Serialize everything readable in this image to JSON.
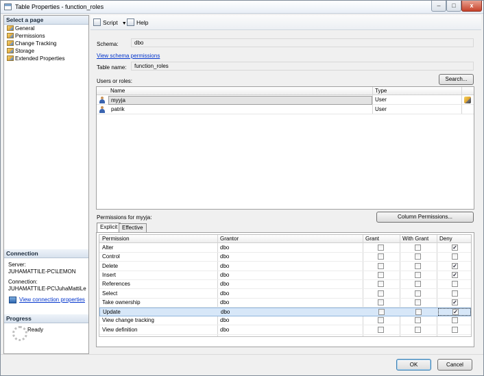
{
  "window": {
    "title": "Table Properties - function_roles",
    "controls": [
      "–",
      "□",
      "x"
    ]
  },
  "sidebar": {
    "select_page_header": "Select a page",
    "pages": [
      "General",
      "Permissions",
      "Change Tracking",
      "Storage",
      "Extended Properties"
    ],
    "connection_header": "Connection",
    "server_label": "Server:",
    "server_value": "JUHAMATTILE-PC\\LEMON",
    "connection_label": "Connection:",
    "connection_value": "JUHAMATTILE-PC\\JuhaMattiLe",
    "view_connection_link": "View connection properties",
    "progress_header": "Progress",
    "progress_status": "Ready"
  },
  "toolbar": {
    "script_label": "Script",
    "help_label": "Help"
  },
  "form": {
    "schema_label": "Schema:",
    "schema_value": "dbo",
    "view_schema_link": "View schema permissions",
    "table_name_label": "Table name:",
    "table_name_value": "function_roles",
    "users_label": "Users or roles:",
    "search_button": "Search...",
    "users_columns": [
      "Name",
      "Type"
    ],
    "users": [
      {
        "name": "myyja",
        "type": "User"
      },
      {
        "name": "patrik",
        "type": "User"
      }
    ],
    "permissions_for_label": "Permissions for myyja:",
    "column_permissions_button": "Column Permissions...",
    "tabs": [
      "Explicit",
      "Effective"
    ],
    "perm_columns": [
      "Permission",
      "Grantor",
      "Grant",
      "With Grant",
      "Deny"
    ],
    "permissions": [
      {
        "name": "Alter",
        "grantor": "dbo",
        "grant": false,
        "with_grant": false,
        "deny": true
      },
      {
        "name": "Control",
        "grantor": "dbo",
        "grant": false,
        "with_grant": false,
        "deny": false
      },
      {
        "name": "Delete",
        "grantor": "dbo",
        "grant": false,
        "with_grant": false,
        "deny": true
      },
      {
        "name": "Insert",
        "grantor": "dbo",
        "grant": false,
        "with_grant": false,
        "deny": true
      },
      {
        "name": "References",
        "grantor": "dbo",
        "grant": false,
        "with_grant": false,
        "deny": false
      },
      {
        "name": "Select",
        "grantor": "dbo",
        "grant": false,
        "with_grant": false,
        "deny": false
      },
      {
        "name": "Take ownership",
        "grantor": "dbo",
        "grant": false,
        "with_grant": false,
        "deny": true
      },
      {
        "name": "Update",
        "grantor": "dbo",
        "grant": false,
        "with_grant": false,
        "deny": true
      },
      {
        "name": "View change tracking",
        "grantor": "dbo",
        "grant": false,
        "with_grant": false,
        "deny": false
      },
      {
        "name": "View definition",
        "grantor": "dbo",
        "grant": false,
        "with_grant": false,
        "deny": false
      }
    ]
  },
  "footer": {
    "ok_button": "OK",
    "cancel_button": "Cancel"
  }
}
